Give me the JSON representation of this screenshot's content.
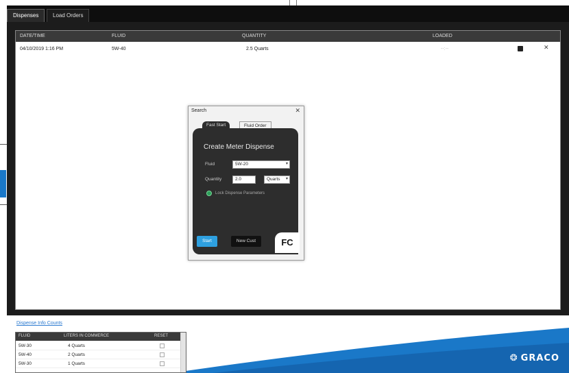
{
  "tabs": [
    {
      "label": "Dispenses",
      "active": true
    },
    {
      "label": "Load Orders",
      "active": false
    }
  ],
  "table": {
    "headers": [
      "DATE/TIME",
      "FLUID",
      "QUANTITY",
      "LOADED"
    ],
    "rows": [
      {
        "datetime": "04/10/2019 1:16 PM",
        "fluid": "5W-40",
        "quantity": "2.5 Quarts",
        "loaded": "--:--"
      }
    ]
  },
  "dialog": {
    "title": "Search",
    "tab_active": "Fast Start",
    "tab_inactive": "Fluid Order",
    "heading": "Create Meter Dispense",
    "fluid_label": "Fluid",
    "fluid_value": "5W-20",
    "quantity_label": "Quantity",
    "quantity_value": "2.0",
    "unit_value": "Quarts",
    "radio_label": "Lock Dispense Parameters",
    "start_button": "Start",
    "new_customer_button": "New Cust",
    "badge": "FC"
  },
  "bottom": {
    "link": "Dispense Info Counts",
    "mini_headers": [
      "FLUID",
      "LITERS IN COMMERCE",
      "RESET"
    ],
    "mini_rows": [
      {
        "fluid": "5W-30",
        "qty": "4 Quarts"
      },
      {
        "fluid": "5W-40",
        "qty": "2 Quarts"
      },
      {
        "fluid": "5W-30",
        "qty": "1 Quarts"
      }
    ],
    "brand": "GRACO"
  },
  "colors": {
    "accent_blue": "#2ea0e0",
    "brand_blue": "#1a78c8",
    "dark_bg": "#1c1c1c"
  }
}
